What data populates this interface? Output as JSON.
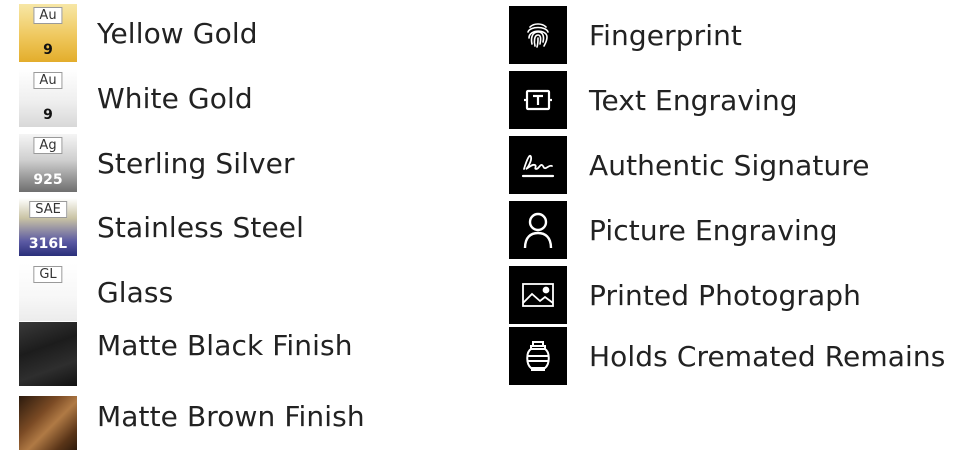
{
  "materials": [
    {
      "name": "Yellow Gold",
      "icon": "yellow-gold-swatch-icon",
      "mark": "Au",
      "value": "9"
    },
    {
      "name": "White Gold",
      "icon": "white-gold-swatch-icon",
      "mark": "Au",
      "value": "9"
    },
    {
      "name": "Sterling Silver",
      "icon": "sterling-silver-swatch-icon",
      "mark": "Ag",
      "value": "925"
    },
    {
      "name": "Stainless Steel",
      "icon": "stainless-steel-swatch-icon",
      "mark": "SAE",
      "value": "316L"
    },
    {
      "name": "Glass",
      "icon": "glass-swatch-icon",
      "mark": "GL",
      "value": ""
    },
    {
      "name": "Matte Black Finish",
      "icon": "matte-black-swatch-icon",
      "mark": "",
      "value": ""
    },
    {
      "name": "Matte Brown Finish",
      "icon": "matte-brown-swatch-icon",
      "mark": "",
      "value": ""
    }
  ],
  "features": [
    {
      "name": "Fingerprint",
      "icon": "fingerprint-icon"
    },
    {
      "name": "Text Engraving",
      "icon": "text-engraving-icon"
    },
    {
      "name": "Authentic Signature",
      "icon": "signature-icon"
    },
    {
      "name": "Picture Engraving",
      "icon": "person-icon"
    },
    {
      "name": "Printed Photograph",
      "icon": "photograph-icon"
    },
    {
      "name": "Holds Cremated Remains",
      "icon": "urn-icon"
    }
  ],
  "colors": {
    "text": "#222222",
    "tile": "#000000",
    "yellow_gold": "#efc85e",
    "steel_blue": "#2a2f7a",
    "brown": "#7a4a24"
  }
}
